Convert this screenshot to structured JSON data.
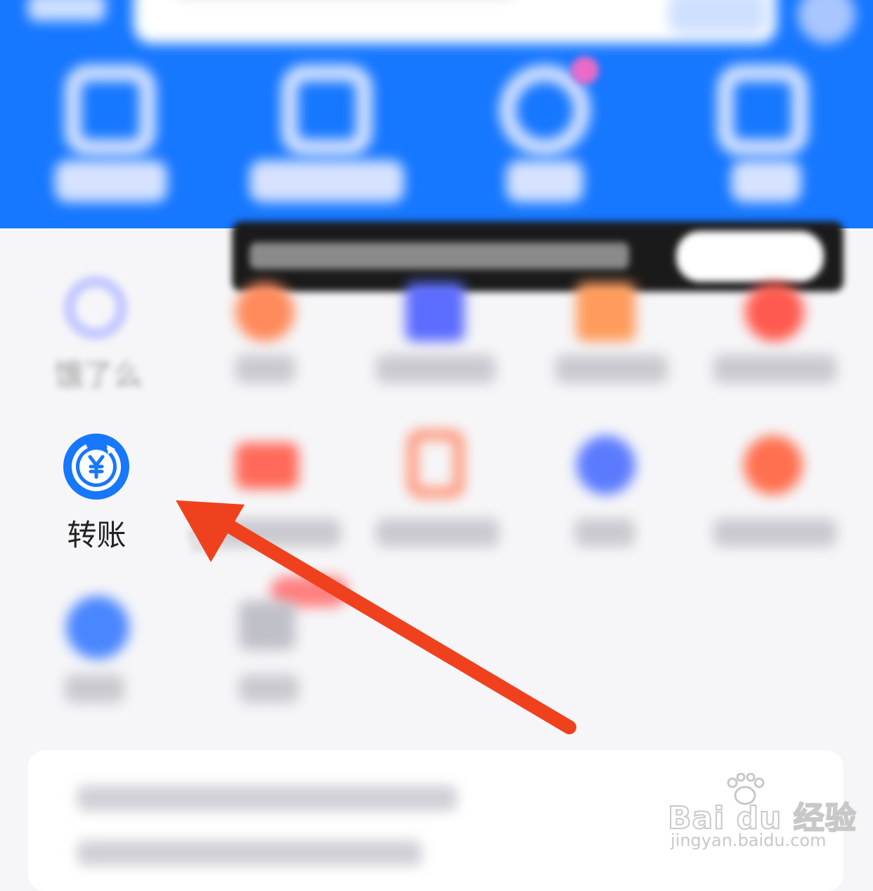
{
  "app": {
    "header_color": "#1677ff",
    "accent_color": "#1677ff",
    "arrow_color": "#f0411f"
  },
  "services": {
    "row1": [
      {
        "label": "饿了么",
        "icon": "eleme-icon"
      }
    ],
    "row2": [
      {
        "label": "转账",
        "icon": "transfer-yuan-icon"
      },
      {
        "label": "信用卡还款",
        "label_visible_part": "信",
        "icon": "credit-card-icon"
      }
    ]
  },
  "watermark": {
    "logo": "Bai du 经验",
    "url": "jingyan.baidu.com"
  }
}
